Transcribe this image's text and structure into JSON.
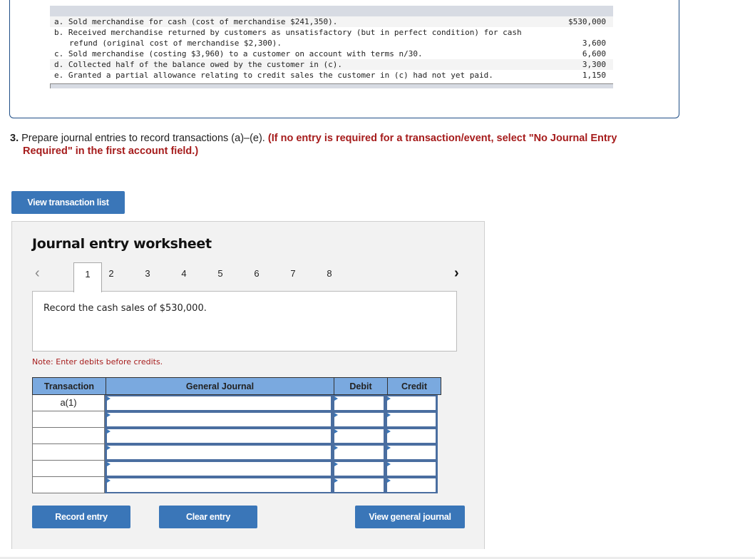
{
  "transactions": [
    {
      "letter": "a.",
      "description": "Sold merchandise for cash (cost of merchandise $241,350).",
      "amount": "$530,000"
    },
    {
      "letter": "b.",
      "description": "Received merchandise returned by customers as unsatisfactory (but in perfect condition) for cash",
      "description_cont": "refund (original cost of merchandise $2,300).",
      "amount": "3,600"
    },
    {
      "letter": "c.",
      "description": "Sold merchandise (costing $3,960) to a customer on account with terms n/30.",
      "amount": "6,600"
    },
    {
      "letter": "d.",
      "description": "Collected half of the balance owed by the customer in (c).",
      "amount": "3,300"
    },
    {
      "letter": "e.",
      "description": "Granted a partial allowance relating to credit sales the customer in (c) had not yet paid.",
      "amount": "1,150"
    }
  ],
  "instruction": {
    "number": "3.",
    "text": " Prepare journal entries to record transactions (a)–(e). ",
    "note_line1": "(If no entry is required for a transaction/event, select \"No Journal Entry",
    "note_line2": "Required\" in the first account field.)"
  },
  "buttons": {
    "view_transaction_list": "View transaction list",
    "record_entry": "Record entry",
    "clear_entry": "Clear entry",
    "view_general_journal": "View general journal"
  },
  "worksheet": {
    "title": "Journal entry worksheet",
    "prev_icon": "‹",
    "next_icon": "›",
    "tabs": [
      "1",
      "2",
      "3",
      "4",
      "5",
      "6",
      "7",
      "8"
    ],
    "active_tab": "1",
    "prompt": "Record the cash sales of $530,000.",
    "note": "Note: Enter debits before credits.",
    "columns": {
      "transaction": "Transaction",
      "general_journal": "General Journal",
      "debit": "Debit",
      "credit": "Credit"
    },
    "rows": [
      {
        "transaction": "a(1)",
        "account": "",
        "debit": "",
        "credit": ""
      },
      {
        "transaction": "",
        "account": "",
        "debit": "",
        "credit": ""
      },
      {
        "transaction": "",
        "account": "",
        "debit": "",
        "credit": ""
      },
      {
        "transaction": "",
        "account": "",
        "debit": "",
        "credit": ""
      },
      {
        "transaction": "",
        "account": "",
        "debit": "",
        "credit": ""
      },
      {
        "transaction": "",
        "account": "",
        "debit": "",
        "credit": ""
      }
    ]
  },
  "colors": {
    "button_blue": "#3a76b8",
    "header_blue": "#7aa9df",
    "note_red": "#a61c1c"
  }
}
